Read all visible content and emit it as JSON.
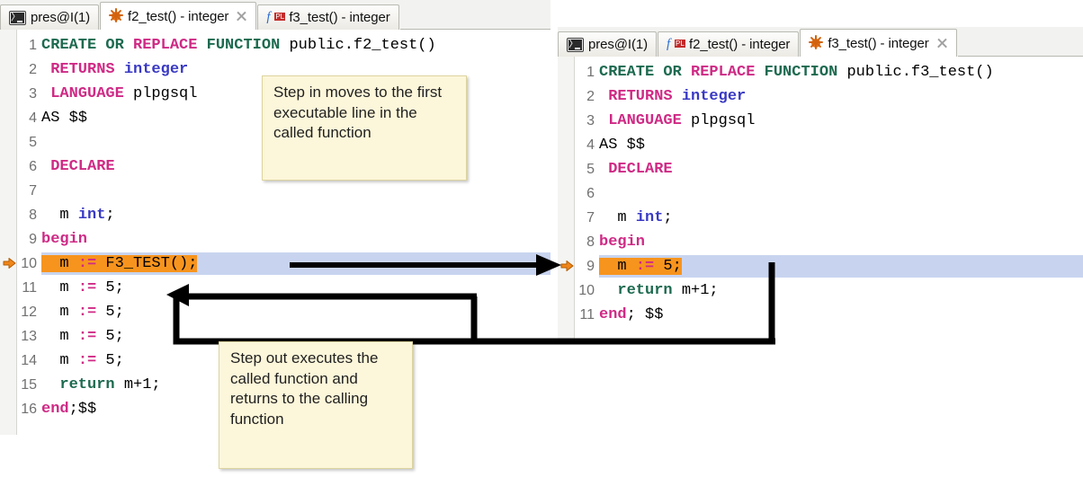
{
  "left_window": {
    "tabs": [
      {
        "label": "pres@I(1)",
        "icon": "console-icon",
        "active": false,
        "closable": false
      },
      {
        "label": "f2_test() - integer",
        "icon": "bug-icon",
        "active": true,
        "closable": true
      },
      {
        "label": "f3_test() - integer",
        "icon": "fpl-icon",
        "active": false,
        "closable": false
      }
    ],
    "code_lines": [
      {
        "num": "1",
        "current": false,
        "tokens": [
          {
            "t": "CREATE OR ",
            "c": "kw2"
          },
          {
            "t": "REPLACE",
            "c": "kw"
          },
          {
            "t": " FUNCTION",
            "c": "kw2"
          },
          {
            "t": " public.f2_test()",
            "c": "pl"
          }
        ]
      },
      {
        "num": "2",
        "current": false,
        "tokens": [
          {
            "t": " RETURNS",
            "c": "kw"
          },
          {
            "t": " ",
            "c": "pl"
          },
          {
            "t": "integer",
            "c": "typ"
          }
        ]
      },
      {
        "num": "3",
        "current": false,
        "tokens": [
          {
            "t": " LANGUAGE",
            "c": "kw"
          },
          {
            "t": " plpgsql",
            "c": "pl"
          }
        ]
      },
      {
        "num": "4",
        "current": false,
        "tokens": [
          {
            "t": "AS $$",
            "c": "pl"
          }
        ]
      },
      {
        "num": "5",
        "current": false,
        "tokens": [
          {
            "t": "",
            "c": "pl"
          }
        ]
      },
      {
        "num": "6",
        "current": false,
        "tokens": [
          {
            "t": " DECLARE",
            "c": "kw"
          }
        ]
      },
      {
        "num": "7",
        "current": false,
        "tokens": [
          {
            "t": "",
            "c": "pl"
          }
        ]
      },
      {
        "num": "8",
        "current": false,
        "tokens": [
          {
            "t": "  m ",
            "c": "pl"
          },
          {
            "t": "int",
            "c": "typ"
          },
          {
            "t": ";",
            "c": "pl"
          }
        ]
      },
      {
        "num": "9",
        "current": false,
        "tokens": [
          {
            "t": "begin",
            "c": "kw"
          }
        ]
      },
      {
        "num": "10",
        "current": true,
        "tokens": [
          {
            "t": "  m ",
            "c": "pl"
          },
          {
            "t": ":=",
            "c": "op"
          },
          {
            "t": " F3_TEST();",
            "c": "pl"
          }
        ]
      },
      {
        "num": "11",
        "current": false,
        "tokens": [
          {
            "t": "  m ",
            "c": "pl"
          },
          {
            "t": ":=",
            "c": "op"
          },
          {
            "t": " 5;",
            "c": "pl"
          }
        ]
      },
      {
        "num": "12",
        "current": false,
        "tokens": [
          {
            "t": "  m ",
            "c": "pl"
          },
          {
            "t": ":=",
            "c": "op"
          },
          {
            "t": " 5;",
            "c": "pl"
          }
        ]
      },
      {
        "num": "13",
        "current": false,
        "tokens": [
          {
            "t": "  m ",
            "c": "pl"
          },
          {
            "t": ":=",
            "c": "op"
          },
          {
            "t": " 5;",
            "c": "pl"
          }
        ]
      },
      {
        "num": "14",
        "current": false,
        "tokens": [
          {
            "t": "  m ",
            "c": "pl"
          },
          {
            "t": ":=",
            "c": "op"
          },
          {
            "t": " 5;",
            "c": "pl"
          }
        ]
      },
      {
        "num": "15",
        "current": false,
        "tokens": [
          {
            "t": "  ",
            "c": "pl"
          },
          {
            "t": "return",
            "c": "kw2"
          },
          {
            "t": " m+1;",
            "c": "pl"
          }
        ]
      },
      {
        "num": "16",
        "current": false,
        "tokens": [
          {
            "t": "end",
            "c": "kw"
          },
          {
            "t": ";$$",
            "c": "pl"
          }
        ]
      }
    ]
  },
  "right_window": {
    "tabs": [
      {
        "label": "pres@I(1)",
        "icon": "console-icon",
        "active": false,
        "closable": false
      },
      {
        "label": "f2_test() - integer",
        "icon": "fpl-icon",
        "active": false,
        "closable": false
      },
      {
        "label": "f3_test() - integer",
        "icon": "bug-icon",
        "active": true,
        "closable": true
      }
    ],
    "code_lines": [
      {
        "num": "1",
        "current": false,
        "tokens": [
          {
            "t": "CREATE OR ",
            "c": "kw2"
          },
          {
            "t": "REPLACE",
            "c": "kw"
          },
          {
            "t": " FUNCTION",
            "c": "kw2"
          },
          {
            "t": " public.f3_test()",
            "c": "pl"
          }
        ]
      },
      {
        "num": "2",
        "current": false,
        "tokens": [
          {
            "t": " RETURNS",
            "c": "kw"
          },
          {
            "t": " ",
            "c": "pl"
          },
          {
            "t": "integer",
            "c": "typ"
          }
        ]
      },
      {
        "num": "3",
        "current": false,
        "tokens": [
          {
            "t": " LANGUAGE",
            "c": "kw"
          },
          {
            "t": " plpgsql",
            "c": "pl"
          }
        ]
      },
      {
        "num": "4",
        "current": false,
        "tokens": [
          {
            "t": "AS $$",
            "c": "pl"
          }
        ]
      },
      {
        "num": "5",
        "current": false,
        "tokens": [
          {
            "t": " DECLARE",
            "c": "kw"
          }
        ]
      },
      {
        "num": "6",
        "current": false,
        "tokens": [
          {
            "t": "",
            "c": "pl"
          }
        ]
      },
      {
        "num": "7",
        "current": false,
        "tokens": [
          {
            "t": "  m ",
            "c": "pl"
          },
          {
            "t": "int",
            "c": "typ"
          },
          {
            "t": ";",
            "c": "pl"
          }
        ]
      },
      {
        "num": "8",
        "current": false,
        "tokens": [
          {
            "t": "begin",
            "c": "kw"
          }
        ]
      },
      {
        "num": "9",
        "current": true,
        "tokens": [
          {
            "t": "  m ",
            "c": "pl"
          },
          {
            "t": ":=",
            "c": "op"
          },
          {
            "t": " 5;",
            "c": "pl"
          }
        ]
      },
      {
        "num": "10",
        "current": false,
        "tokens": [
          {
            "t": "  ",
            "c": "pl"
          },
          {
            "t": "return",
            "c": "kw2"
          },
          {
            "t": " m+1;",
            "c": "pl"
          }
        ]
      },
      {
        "num": "11",
        "current": false,
        "tokens": [
          {
            "t": "end",
            "c": "kw"
          },
          {
            "t": "; $$",
            "c": "pl"
          }
        ]
      }
    ]
  },
  "callouts": {
    "step_in": "Step in moves to the first executable line in the called function",
    "step_out": "Step out executes the called function and returns to the calling function"
  },
  "colors": {
    "current_line_highlight": "#f7941e",
    "current_row_band": "#c8d4ef",
    "keyword": "#cf2a85",
    "keyword_alt": "#1d6a4f",
    "type": "#3939c4",
    "callout_bg": "#fcf6da",
    "callout_border": "#ded49e",
    "arrow": "#000000",
    "step_marker": "#f0861a"
  }
}
